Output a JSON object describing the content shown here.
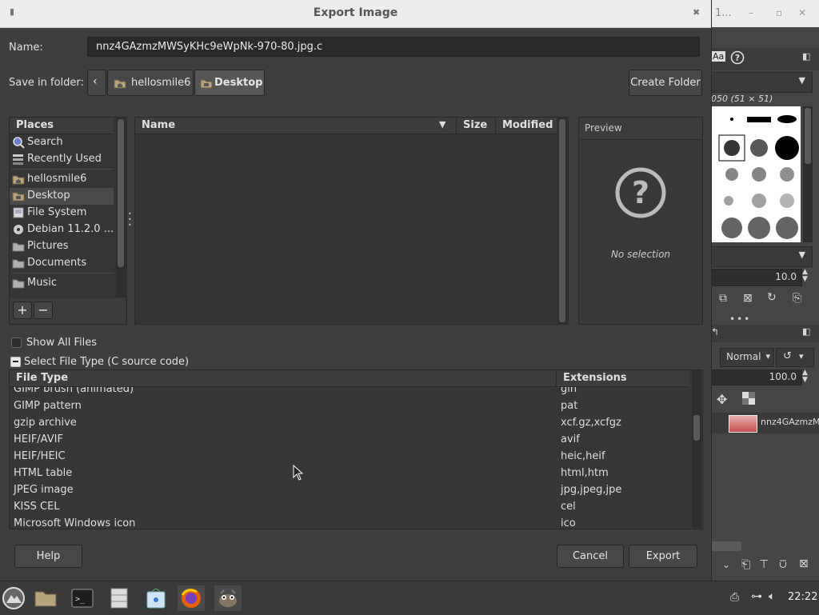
{
  "background_window": {
    "title": "1...",
    "brushes_label": "050 (51 × 51)",
    "size_value": "10.0",
    "mode_value": "Normal",
    "opacity_value": "100.0",
    "layer_name": "nnz4GAzmzM"
  },
  "dialog": {
    "title": "Export Image",
    "name_label": "Name:",
    "name_value": "nnz4GAzmzMWSyKHc9eWpNk-970-80.jpg.c",
    "save_in_label": "Save in folder:",
    "path": [
      "hellosmile6",
      "Desktop"
    ],
    "create_folder": "Create Folder",
    "places_header": "Places",
    "places": [
      {
        "label": "Search",
        "icon": "search-icon"
      },
      {
        "label": "Recently Used",
        "icon": "recent-icon"
      },
      {
        "label": "hellosmile6",
        "icon": "home-folder-icon"
      },
      {
        "label": "Desktop",
        "icon": "desktop-folder-icon"
      },
      {
        "label": "File System",
        "icon": "drive-icon"
      },
      {
        "label": "Debian 11.2.0 ...",
        "icon": "disc-icon"
      },
      {
        "label": "Pictures",
        "icon": "folder-icon"
      },
      {
        "label": "Documents",
        "icon": "folder-icon"
      },
      {
        "label": "Music",
        "icon": "folder-icon"
      }
    ],
    "files_columns": {
      "name": "Name",
      "size": "Size",
      "modified": "Modified"
    },
    "preview_header": "Preview",
    "no_selection": "No selection",
    "show_all_files": "Show All Files",
    "select_file_type": "Select File Type (C source code)",
    "filetype_columns": {
      "type": "File Type",
      "ext": "Extensions"
    },
    "filetypes": [
      {
        "type": "GIMP brush (animated)",
        "ext": "gih"
      },
      {
        "type": "GIMP pattern",
        "ext": "pat"
      },
      {
        "type": "gzip archive",
        "ext": "xcf.gz,xcfgz"
      },
      {
        "type": "HEIF/AVIF",
        "ext": "avif"
      },
      {
        "type": "HEIF/HEIC",
        "ext": "heic,heif"
      },
      {
        "type": "HTML table",
        "ext": "html,htm"
      },
      {
        "type": "JPEG image",
        "ext": "jpg,jpeg,jpe"
      },
      {
        "type": "KISS CEL",
        "ext": "cel"
      },
      {
        "type": "Microsoft Windows icon",
        "ext": "ico"
      }
    ],
    "help": "Help",
    "cancel": "Cancel",
    "export": "Export"
  },
  "taskbar": {
    "clock": "22:22"
  },
  "colors": {
    "dialog_bg": "#3e3e3e",
    "title_bar": "#ececec",
    "selected_place": "#4a4a4a"
  }
}
